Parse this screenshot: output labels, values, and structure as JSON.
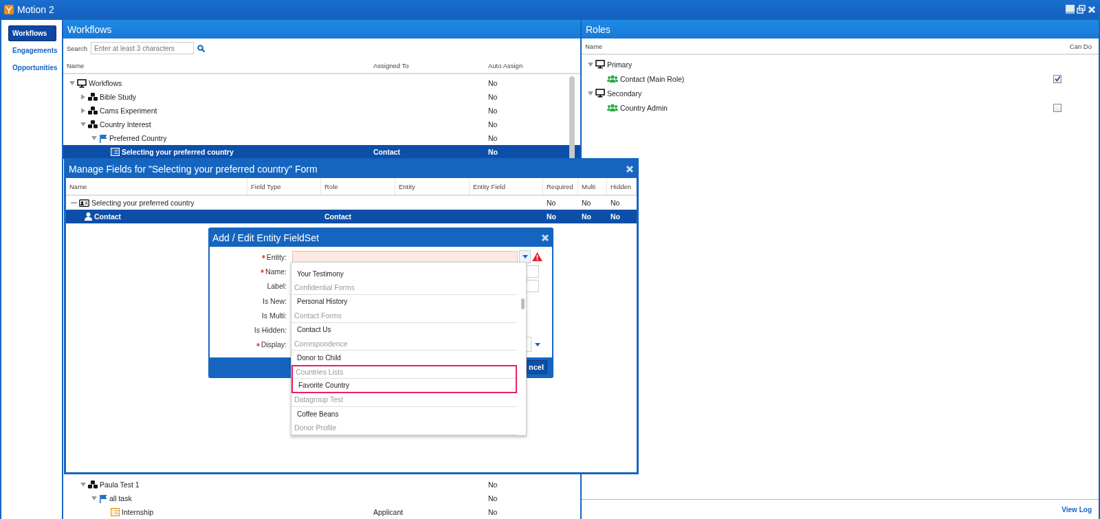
{
  "window": {
    "title": "Motion 2"
  },
  "sidebar": {
    "items": [
      {
        "label": "Workflows",
        "selected": true
      },
      {
        "label": "Engagements",
        "selected": false
      },
      {
        "label": "Opportunities",
        "selected": false
      }
    ]
  },
  "workflows": {
    "title": "Workflows",
    "search": {
      "label": "Search",
      "placeholder": "Enter at least 3 characters"
    },
    "columns": [
      "Name",
      "Assigned To",
      "Auto Assign"
    ],
    "tree": [
      {
        "name": "Workflows",
        "kind": "root",
        "expanded": true,
        "selected": false,
        "auto_assign": "No",
        "children": [
          {
            "name": "Bible Study",
            "kind": "workflow",
            "expanded": false,
            "selected": false,
            "auto_assign": "No"
          },
          {
            "name": "Cams Experiment",
            "kind": "workflow",
            "expanded": false,
            "selected": false,
            "auto_assign": "No"
          },
          {
            "name": "Country Interest",
            "kind": "workflow",
            "expanded": true,
            "selected": false,
            "auto_assign": "No",
            "children": [
              {
                "name": "Preferred Country",
                "kind": "step",
                "expanded": true,
                "selected": false,
                "auto_assign": "No",
                "children": [
                  {
                    "name": "Selecting your preferred country",
                    "kind": "form",
                    "selected": true,
                    "assigned_to": "Contact",
                    "auto_assign": "No"
                  }
                ]
              }
            ]
          },
          {
            "name": "Paula Test 1",
            "kind": "workflow",
            "expanded": true,
            "selected": false,
            "auto_assign": "No",
            "children": [
              {
                "name": "all task",
                "kind": "step",
                "expanded": true,
                "selected": false,
                "auto_assign": "No",
                "children": [
                  {
                    "name": "Internship",
                    "kind": "form-alt",
                    "selected": false,
                    "assigned_to": "Applicant",
                    "auto_assign": "No"
                  }
                ]
              }
            ]
          }
        ]
      }
    ]
  },
  "roles": {
    "title": "Roles",
    "columns": [
      "Name",
      "Can Do"
    ],
    "tree": [
      {
        "name": "Primary",
        "kind": "root",
        "expanded": true,
        "children": [
          {
            "name": "Contact (Main Role)",
            "kind": "role",
            "checked": true
          }
        ]
      },
      {
        "name": "Secondary",
        "kind": "root",
        "expanded": true,
        "children": [
          {
            "name": "Country Admin",
            "kind": "role",
            "checked": false
          }
        ]
      }
    ],
    "footer_link": "View Log"
  },
  "manage_fields_dialog": {
    "title": "Manage Fields for \"Selecting your preferred country\" Form",
    "columns": [
      "Name",
      "Field Type",
      "Role",
      "Entity",
      "Entity Field",
      "Required",
      "Multi",
      "Hidden"
    ],
    "rows": [
      {
        "name": "Selecting your preferred country",
        "kind": "form",
        "selected": false,
        "required": "No",
        "multi": "No",
        "hidden": "No",
        "children": [
          {
            "name": "Contact",
            "kind": "person",
            "selected": true,
            "role": "Contact",
            "required": "No",
            "multi": "No",
            "hidden": "No"
          }
        ]
      }
    ]
  },
  "entity_dialog": {
    "title": "Add / Edit Entity FieldSet",
    "fields": [
      {
        "label": "Entity:",
        "required": true,
        "kind": "select",
        "error": true
      },
      {
        "label": "Name:",
        "required": true,
        "kind": "text"
      },
      {
        "label": "Label:",
        "required": false,
        "kind": "text"
      },
      {
        "label": "Is New:",
        "required": false
      },
      {
        "label": "Is Multi:",
        "required": false
      },
      {
        "label": "Is Hidden:",
        "required": false
      },
      {
        "label": "Display:",
        "required": true,
        "kind": "dropdown"
      }
    ],
    "dropdown_options": [
      {
        "label": "Your Testimony",
        "kind": "item",
        "highlighted": false
      },
      {
        "label": "Confidential Forms",
        "kind": "group",
        "highlighted": false
      },
      {
        "label": "Personal History",
        "kind": "item",
        "highlighted": false
      },
      {
        "label": "Contact Forms",
        "kind": "group",
        "highlighted": false
      },
      {
        "label": "Contact Us",
        "kind": "item",
        "highlighted": false
      },
      {
        "label": "Correspondence",
        "kind": "group",
        "highlighted": false
      },
      {
        "label": "Donor to Child",
        "kind": "item",
        "highlighted": false
      },
      {
        "label": "Countries Lists",
        "kind": "group",
        "highlighted": true
      },
      {
        "label": "Favorite Country",
        "kind": "item",
        "highlighted": true
      },
      {
        "label": "Datagroup Test",
        "kind": "group",
        "highlighted": false
      },
      {
        "label": "Coffee Beans",
        "kind": "item",
        "highlighted": false
      },
      {
        "label": "Donor Profile",
        "kind": "group",
        "highlighted": false
      }
    ],
    "footer_button": "ncel"
  }
}
